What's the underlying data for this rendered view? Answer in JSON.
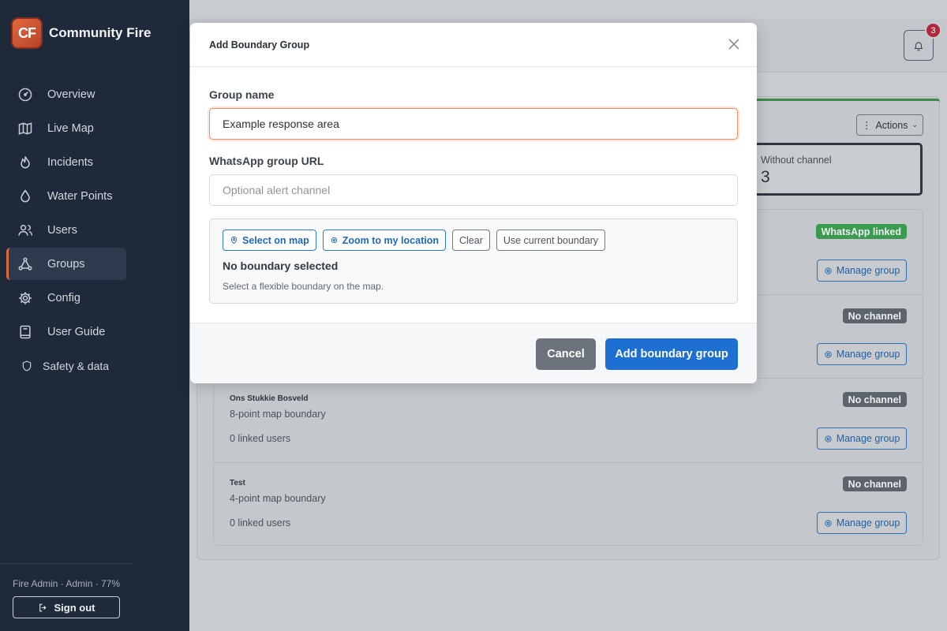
{
  "sidebar": {
    "logo_text": "CF",
    "brand_name": "Community Fire",
    "items": [
      {
        "label": "Overview",
        "icon": "gauge-icon"
      },
      {
        "label": "Live Map",
        "icon": "map-icon"
      },
      {
        "label": "Incidents",
        "icon": "flame-icon"
      },
      {
        "label": "Water Points",
        "icon": "droplet-icon"
      },
      {
        "label": "Users",
        "icon": "users-icon"
      },
      {
        "label": "Groups",
        "icon": "network-icon",
        "active": true
      },
      {
        "label": "Config",
        "icon": "gear-icon"
      },
      {
        "label": "User Guide",
        "icon": "book-icon"
      },
      {
        "label": "Safety & data",
        "icon": "shield-icon"
      }
    ],
    "user_info": "Fire Admin · Admin · 77%",
    "signout_label": "Sign out"
  },
  "header": {
    "notification_count": "3"
  },
  "background": {
    "actions_label": "Actions",
    "stat": {
      "label": "Without channel",
      "value": "3"
    },
    "groups": [
      {
        "title": "",
        "subtitle": "",
        "users": "",
        "badge": "WhatsApp linked",
        "badge_color": "#3a9b4e",
        "manage": "Manage group"
      },
      {
        "title": "",
        "subtitle": "",
        "users": "",
        "badge": "No channel",
        "badge_color": "#5d636b",
        "manage": "Manage group"
      },
      {
        "title": "Ons Stukkie Bosveld",
        "subtitle": "8-point map boundary",
        "users": "0 linked users",
        "badge": "No channel",
        "badge_color": "#5d636b",
        "manage": "Manage group"
      },
      {
        "title": "Test",
        "subtitle": "4-point map boundary",
        "users": "0 linked users",
        "badge": "No channel",
        "badge_color": "#5d636b",
        "manage": "Manage group"
      }
    ]
  },
  "modal": {
    "title": "Add Boundary Group",
    "group_name_label": "Group name",
    "group_name_value": "Example response area",
    "whatsapp_label": "WhatsApp group URL",
    "whatsapp_placeholder": "Optional alert channel",
    "buttons": {
      "select_on_map": "Select on map",
      "zoom_to_location": "Zoom to my location",
      "clear": "Clear",
      "use_current": "Use current boundary"
    },
    "boundary_status": "No boundary selected",
    "boundary_hint": "Select a flexible boundary on the map.",
    "cancel_label": "Cancel",
    "submit_label": "Add boundary group"
  },
  "colors": {
    "sidebar_bg": "#1e2939",
    "accent": "#e0683d",
    "primary": "#1e6fd2",
    "success": "#3a9b4e"
  }
}
